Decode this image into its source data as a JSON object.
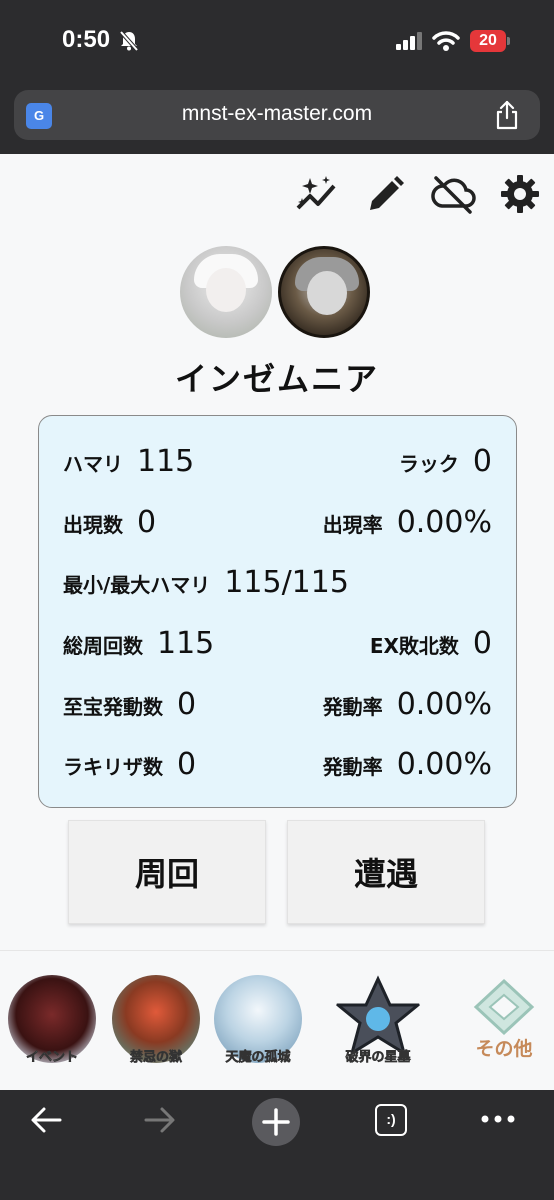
{
  "status_bar": {
    "time": "0:50",
    "battery": "20",
    "icons": [
      "bell-slash-icon",
      "signal-icon",
      "wifi-icon"
    ]
  },
  "browser": {
    "url": "mnst-ex-master.com",
    "translate_icon_text": "G",
    "icons": [
      "translate-icon",
      "share-icon"
    ]
  },
  "toolbar": {
    "icons": [
      "sparkle-chart-icon",
      "pencil-icon",
      "cloud-off-icon",
      "gear-icon"
    ]
  },
  "character": {
    "name": "インゼムニア"
  },
  "stats": {
    "hamari": {
      "label": "ハマリ",
      "value": "115"
    },
    "luck": {
      "label": "ラック",
      "value": "0"
    },
    "appear_count": {
      "label": "出現数",
      "value": "0"
    },
    "appear_rate": {
      "label": "出現率",
      "value": "0.00%"
    },
    "min_max_hamari": {
      "label": "最小/最大ハマリ",
      "value": "115/115"
    },
    "total_runs": {
      "label": "総周回数",
      "value": "115"
    },
    "ex_defeats": {
      "label": "EX敗北数",
      "value": "0"
    },
    "treasure_count": {
      "label": "至宝発動数",
      "value": "0"
    },
    "treasure_rate": {
      "label": "発動率",
      "value": "0.00%"
    },
    "lucky_count": {
      "label": "ラキリザ数",
      "value": "0"
    },
    "lucky_rate": {
      "label": "発動率",
      "value": "0.00%"
    }
  },
  "buttons": {
    "lap": "周回",
    "encounter": "遭遇"
  },
  "bottom_nav": {
    "items": [
      {
        "label": "イベント"
      },
      {
        "label": "禁忌の獄"
      },
      {
        "label": "天魔の孤城"
      },
      {
        "label": "破界の星墓"
      },
      {
        "label": "その他"
      }
    ]
  },
  "browser_toolbar": {
    "tab_icon_text": ":)",
    "icons": [
      "back-arrow-icon",
      "forward-arrow-icon",
      "new-tab-icon",
      "tabs-icon",
      "more-icon"
    ]
  }
}
